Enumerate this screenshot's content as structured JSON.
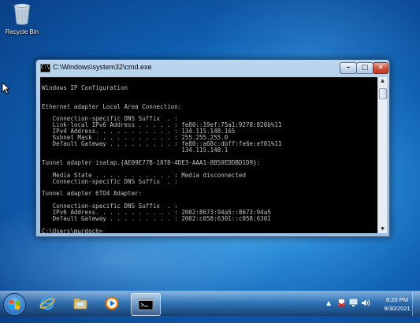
{
  "desktop": {
    "icons": [
      {
        "label": "Recycle Bin",
        "icon": "recycle-bin-icon"
      }
    ]
  },
  "window": {
    "title": "C:\\Windows\\system32\\cmd.exe",
    "icon": "cmd-icon",
    "controls": {
      "minimize": "minimize-icon",
      "maximize": "maximize-icon",
      "close": "close-icon"
    },
    "console_lines": [
      "",
      "Windows IP Configuration",
      "",
      "",
      "Ethernet adapter Local Area Connection:",
      "",
      "   Connection-specific DNS Suffix  . :",
      "   Link-local IPv6 Address . . . . . : fe80::19ef:75a1:9278:820b%11",
      "   IPv4 Address. . . . . . . . . . . : 134.115.148.165",
      "   Subnet Mask . . . . . . . . . . . : 255.255.255.0",
      "   Default Gateway . . . . . . . . . : fe80::a68c:dbff:fe6e:ef01%11",
      "                                       134.115.148.1",
      "",
      "Tunnel adapter isatap.{AE09E77B-1878-4DE3-AAA1-8B50EDDBD1D9}:",
      "",
      "   Media State . . . . . . . . . . . : Media disconnected",
      "   Connection-specific DNS Suffix  . :",
      "",
      "Tunnel adapter 6TO4 Adapter:",
      "",
      "   Connection-specific DNS Suffix  . :",
      "   IPv6 Address. . . . . . . . . . . : 2002:8673:94a5::8673:94a5",
      "   Default Gateway . . . . . . . . . : 2002:c058:6301::c058:6301",
      "",
      "C:\\Users\\murdoch>"
    ]
  },
  "taskbar": {
    "start_icon": "windows-start-icon",
    "pinned": [
      {
        "name": "internet-explorer-icon",
        "active": false
      },
      {
        "name": "windows-explorer-icon",
        "active": false
      },
      {
        "name": "media-player-icon",
        "active": false
      },
      {
        "name": "cmd-icon",
        "active": true
      }
    ],
    "tray": {
      "icons": [
        "show-hidden-icons-icon",
        "action-center-icon",
        "network-icon",
        "volume-icon"
      ],
      "time": "8:20 PM",
      "date": "9/30/2021"
    }
  },
  "colors": {
    "console_bg": "#000000",
    "console_fg": "#c0c0c0"
  }
}
